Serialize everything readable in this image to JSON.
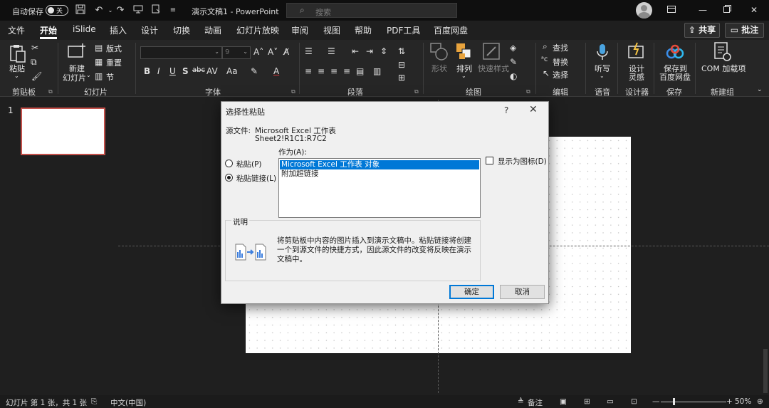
{
  "titlebar": {
    "autosave_label": "自动保存",
    "autosave_state": "关",
    "doc_title": "演示文稿1 - PowerPoint",
    "search_placeholder": "搜索",
    "qa_icons": [
      "save-icon",
      "undo-icon",
      "redo-icon",
      "present-icon",
      "touch-mode-icon",
      "customize-icon"
    ]
  },
  "tabs": [
    "文件",
    "开始",
    "iSlide",
    "插入",
    "设计",
    "切换",
    "动画",
    "幻灯片放映",
    "审阅",
    "视图",
    "帮助",
    "PDF工具",
    "百度网盘"
  ],
  "active_tab": "开始",
  "share_label": "共享",
  "comment_label": "批注",
  "ribbon": {
    "clipboard": {
      "paste": "粘贴",
      "group": "剪贴板"
    },
    "slides": {
      "new_slide_1": "新建",
      "new_slide_2": "幻灯片",
      "layout": "版式",
      "reset": "重置",
      "section": "节",
      "group": "幻灯片"
    },
    "font": {
      "size": "9",
      "group": "字体",
      "bold": "B",
      "italic": "I",
      "underline": "U",
      "strike": "S",
      "shadow": "abc"
    },
    "paragraph": {
      "group": "段落"
    },
    "drawing": {
      "shapes": "形状",
      "arrange": "排列",
      "quick_styles": "快速样式",
      "group": "绘图"
    },
    "editing": {
      "find": "查找",
      "replace": "替换",
      "select": "选择",
      "group": "编辑"
    },
    "voice": {
      "dictate": "听写",
      "group": "语音"
    },
    "designer": {
      "label_1": "设计",
      "label_2": "灵感",
      "group": "设计器"
    },
    "save": {
      "label_1": "保存到",
      "label_2": "百度网盘",
      "group": "保存"
    },
    "com": {
      "label": "COM 加载项",
      "group": "新建组"
    }
  },
  "thumbnail_number": "1",
  "dialog": {
    "title": "选择性粘贴",
    "help": "?",
    "source_label": "源文件:",
    "source_name": "Microsoft Excel 工作表",
    "source_range": "Sheet2!R1C1:R7C2",
    "as_label": "作为(A):",
    "radio_paste": "粘贴(P)",
    "radio_paste_link": "粘贴链接(L)",
    "list_items": [
      "Microsoft Excel 工作表 对象",
      "附加超链接"
    ],
    "display_as_icon": "显示为图标(D)",
    "description_label": "说明",
    "description": "将剪贴板中内容的图片插入到演示文稿中。粘贴链接将创建一个到源文件的快捷方式，因此源文件的改变将反映在演示文稿中。",
    "ok": "确定",
    "cancel": "取消"
  },
  "statusbar": {
    "slide_info": "幻灯片 第 1 张，共 1 张",
    "language": "中文(中国)",
    "notes": "备注",
    "zoom": "50%"
  }
}
